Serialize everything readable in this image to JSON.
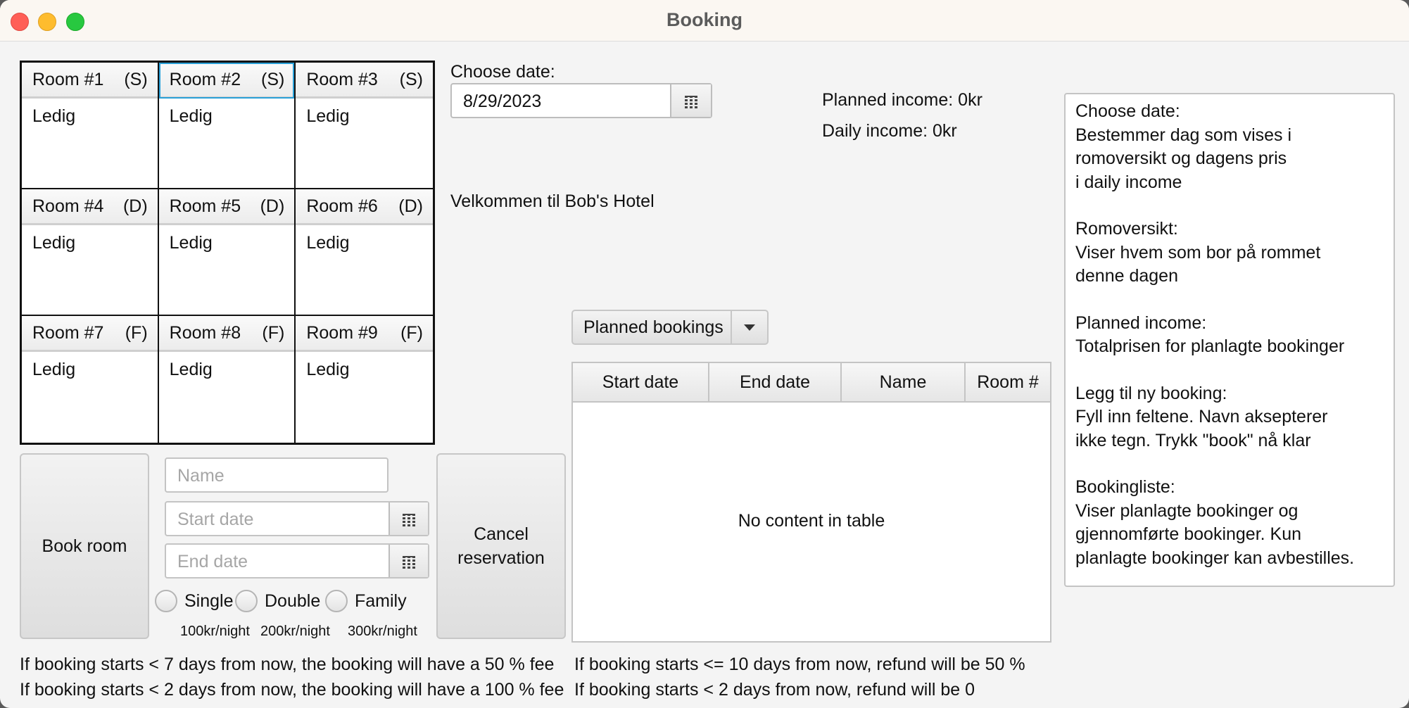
{
  "window": {
    "title": "Booking"
  },
  "rooms": [
    {
      "name": "Room #1",
      "type": "(S)",
      "status": "Ledig"
    },
    {
      "name": "Room #2",
      "type": "(S)",
      "status": "Ledig"
    },
    {
      "name": "Room #3",
      "type": "(S)",
      "status": "Ledig"
    },
    {
      "name": "Room #4",
      "type": "(D)",
      "status": "Ledig"
    },
    {
      "name": "Room #5",
      "type": "(D)",
      "status": "Ledig"
    },
    {
      "name": "Room #6",
      "type": "(D)",
      "status": "Ledig"
    },
    {
      "name": "Room #7",
      "type": "(F)",
      "status": "Ledig"
    },
    {
      "name": "Room #8",
      "type": "(F)",
      "status": "Ledig"
    },
    {
      "name": "Room #9",
      "type": "(F)",
      "status": "Ledig"
    }
  ],
  "date_picker": {
    "label": "Choose date:",
    "value": "8/29/2023"
  },
  "income": {
    "planned": "Planned income: 0kr",
    "daily": "Daily income: 0kr"
  },
  "welcome": "Velkommen til Bob's Hotel",
  "help": [
    "Choose date:\nBestemmer dag som vises i\nromoversikt og dagens pris\ni daily income",
    "Romoversikt:\nViser hvem som bor på rommet\ndenne dagen",
    "Planned income:\nTotalprisen for planlagte bookinger",
    "Legg til ny booking:\nFyll inn feltene. Navn aksepterer\nikke tegn. Trykk \"book\" nå klar",
    "Bookingliste:\nViser planlagte bookinger og\ngjennomførte bookinger. Kun\nplanlagte bookinger kan avbestilles."
  ],
  "form": {
    "book_label": "Book room",
    "cancel_label": "Cancel reservation",
    "name_placeholder": "Name",
    "start_placeholder": "Start date",
    "end_placeholder": "End date",
    "room_types": [
      {
        "label": "Single",
        "price": "100kr/night"
      },
      {
        "label": "Double",
        "price": "200kr/night"
      },
      {
        "label": "Family",
        "price": "300kr/night"
      }
    ]
  },
  "fees": {
    "line1": "If booking starts < 7 days from now, the booking will have a 50 % fee",
    "line2": "If booking starts < 2 days from now, the booking will have a 100 % fee"
  },
  "refunds": {
    "line1": "If booking starts <= 10 days from now, refund will be 50 %",
    "line2": "If booking starts < 2 days from now, refund will be 0"
  },
  "bookings": {
    "filter_value": "Planned bookings",
    "columns": [
      "Start date",
      "End date",
      "Name",
      "Room #"
    ],
    "empty_text": "No content in table"
  }
}
